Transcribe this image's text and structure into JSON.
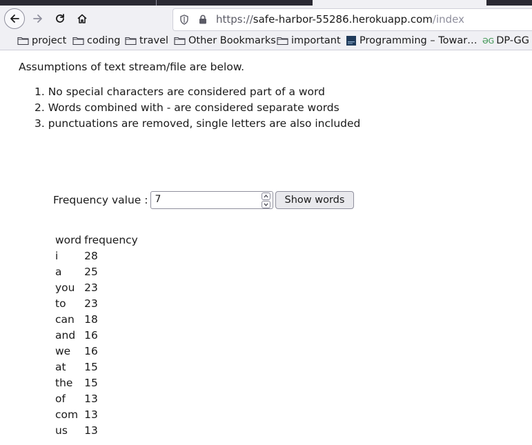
{
  "browser": {
    "url_scheme": "https://",
    "url_host": "safe-harbor-55286.herokuapp.com",
    "url_path": "/index"
  },
  "bookmarks": [
    {
      "label": "project",
      "icon": "folder-icon"
    },
    {
      "label": "coding",
      "icon": "folder-icon"
    },
    {
      "label": "travel",
      "icon": "folder-icon"
    },
    {
      "label": "Other Bookmarks",
      "icon": "folder-icon"
    },
    {
      "label": "important",
      "icon": "folder-icon"
    },
    {
      "label": "Programming – Towar…",
      "icon": "favicon-icon"
    },
    {
      "label": "DP-GG",
      "icon": "gfg-icon"
    }
  ],
  "page": {
    "intro": "Assumptions of text stream/file are below.",
    "rules": [
      "1. No special characters are considered part of a word",
      "2. Words combined with - are considered separate words",
      "3. punctuations are removed, single letters are also included"
    ],
    "frequency_label": "Frequency value :",
    "frequency_value": "7",
    "show_button": "Show words",
    "table_headers": [
      "word",
      "frequency"
    ],
    "rows": [
      [
        "i",
        "28"
      ],
      [
        "a",
        "25"
      ],
      [
        "you",
        "23"
      ],
      [
        "to",
        "23"
      ],
      [
        "can",
        "18"
      ],
      [
        "and",
        "16"
      ],
      [
        "we",
        "16"
      ],
      [
        "at",
        "15"
      ],
      [
        "the",
        "15"
      ],
      [
        "of",
        "13"
      ],
      [
        "com",
        "13"
      ],
      [
        "us",
        "13"
      ]
    ]
  }
}
